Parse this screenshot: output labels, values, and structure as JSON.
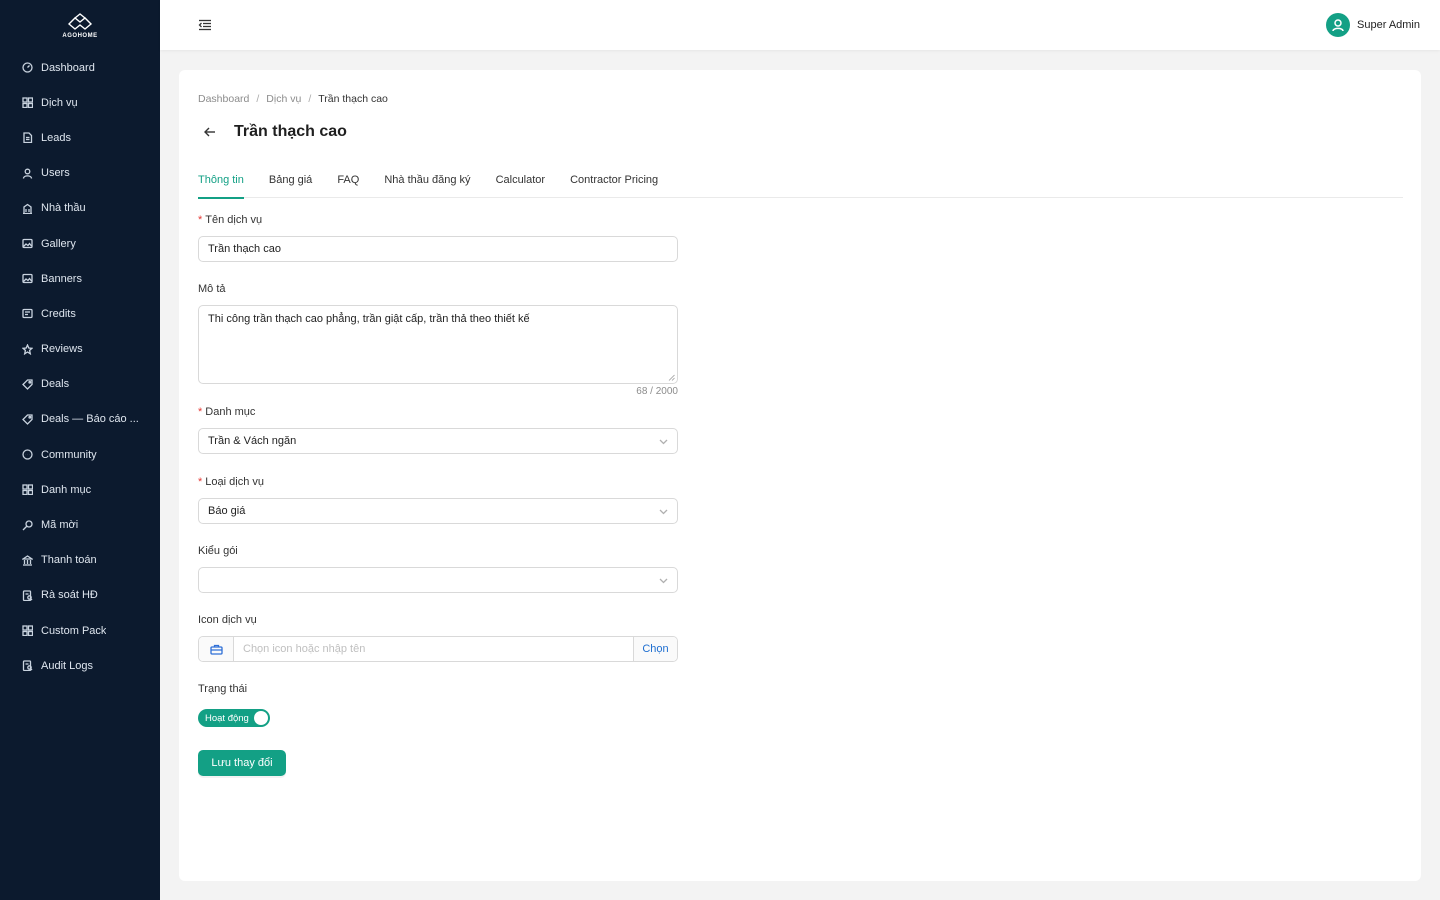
{
  "brand": {
    "name": "AGOHOME"
  },
  "sidebar": {
    "items": [
      {
        "label": "Dashboard",
        "icon": "dashboard-icon"
      },
      {
        "label": "Dịch vụ",
        "icon": "grid-icon"
      },
      {
        "label": "Leads",
        "icon": "file-icon"
      },
      {
        "label": "Users",
        "icon": "user-icon"
      },
      {
        "label": "Nhà thầu",
        "icon": "building-icon"
      },
      {
        "label": "Gallery",
        "icon": "image-icon"
      },
      {
        "label": "Banners",
        "icon": "image-icon"
      },
      {
        "label": "Credits",
        "icon": "wallet-icon"
      },
      {
        "label": "Reviews",
        "icon": "star-icon"
      },
      {
        "label": "Deals",
        "icon": "tag-icon"
      },
      {
        "label": "Deals — Báo cáo ...",
        "icon": "tag-icon"
      },
      {
        "label": "Community",
        "icon": "chat-icon"
      },
      {
        "label": "Danh mục",
        "icon": "grid-icon"
      },
      {
        "label": "Mã mời",
        "icon": "key-icon"
      },
      {
        "label": "Thanh toán",
        "icon": "bank-icon"
      },
      {
        "label": "Rà soát HĐ",
        "icon": "audit-icon"
      },
      {
        "label": "Custom Pack",
        "icon": "grid-icon"
      },
      {
        "label": "Audit Logs",
        "icon": "audit-icon"
      }
    ]
  },
  "header": {
    "user_name": "Super Admin"
  },
  "breadcrumb": {
    "items": [
      "Dashboard",
      "Dịch vụ"
    ],
    "current": "Trần thạch cao"
  },
  "page": {
    "title": "Trần thạch cao"
  },
  "tabs": [
    "Thông tin",
    "Bảng giá",
    "FAQ",
    "Nhà thầu đăng ký",
    "Calculator",
    "Contractor Pricing"
  ],
  "active_tab": "Thông tin",
  "form": {
    "name": {
      "label": "Tên dịch vụ",
      "value": "Trần thạch cao",
      "required": true
    },
    "description": {
      "label": "Mô tả",
      "value": "Thi công trần thạch cao phẳng, trần giật cấp, trần thả theo thiết kế",
      "counter": "68 / 2000"
    },
    "category": {
      "label": "Danh mục",
      "value": "Trần & Vách ngăn",
      "required": true
    },
    "service_type": {
      "label": "Loại dịch vụ",
      "value": "Báo giá",
      "required": true
    },
    "package_type": {
      "label": "Kiểu gói",
      "value": ""
    },
    "icon": {
      "label": "Icon dịch vụ",
      "placeholder": "Chọn icon hoặc nhập tên",
      "button": "Chọn"
    },
    "status": {
      "label": "Trạng thái",
      "value": "Hoạt động",
      "on": true
    },
    "save_label": "Lưu thay đổi"
  },
  "colors": {
    "primary": "#13a085",
    "sidebar_bg": "#0c1a2e",
    "link": "#1f6fd1"
  }
}
